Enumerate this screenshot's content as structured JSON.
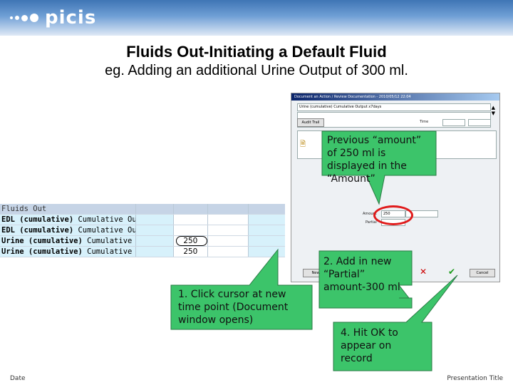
{
  "brand": {
    "logo_text": "picis"
  },
  "slide": {
    "title": "Fluids Out-Initiating a Default Fluid",
    "subtitle": "eg. Adding an additional Urine Output of 300 ml."
  },
  "grid": {
    "header": "Fluids Out",
    "rows": [
      {
        "bold_part": "EDL (cumulative)",
        "rest": " Cumulative Output",
        "value": ""
      },
      {
        "bold_part": "EDL (cumulative)",
        "rest": " Cumulative Output...",
        "value": ""
      },
      {
        "bold_part": "Urine (cumulative)",
        "rest": " Cumulative Outpu...",
        "value": "250"
      },
      {
        "bold_part": "Urine (cumulative)",
        "rest": " Cumulative Outpu...",
        "value": "250"
      }
    ]
  },
  "dialog": {
    "title": "Document an Action / Review Documentation - 2010/05/12 22:04",
    "field_name": "Urine (cumulative) Cumulative Output x7days",
    "time_label": "Time",
    "audit_button": "Audit Trail",
    "amount_label": "Amount",
    "amount_value": "250",
    "partial_label": "Partial",
    "new_button": "New",
    "cancel_button": "Cancel"
  },
  "callouts": {
    "previous_amount": "Previous “amount” of 250 ml is displayed in the “Amount”",
    "click_cursor": "1. Click cursor at new time point (Document window opens)",
    "add_partial": "2. Add in new “Partial” amount-300 ml",
    "hit_ok": "4. Hit OK to appear on record"
  },
  "footer": {
    "left": "Date",
    "right": "Presentation Title"
  },
  "colors": {
    "callout_fill": "#3cc46a",
    "ring": "#e01b1b",
    "header_blue": "#3f75b5"
  }
}
